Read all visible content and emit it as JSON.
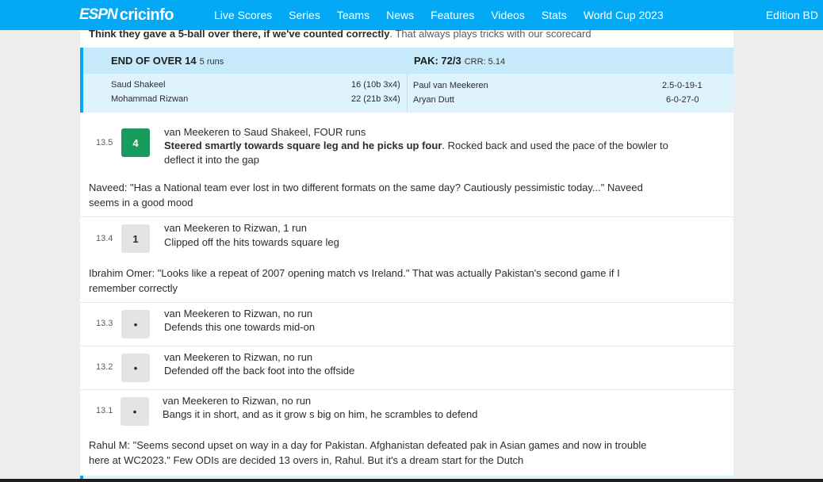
{
  "nav": {
    "logo_espn": "ESPN",
    "logo_cricinfo": "cricinfo",
    "items": [
      "Live Scores",
      "Series",
      "Teams",
      "News",
      "Features",
      "Videos",
      "Stats",
      "World Cup 2023"
    ],
    "edition": "Edition BD"
  },
  "teaser": {
    "bold": "Think they gave a 5-ball over there, if we've counted correctly",
    "rest": ". That always plays tricks with our scorecard"
  },
  "over_summary": {
    "title": "END OF OVER 14",
    "runs": "5 runs",
    "score": "PAK: 72/3",
    "crr": "CRR: 5.14",
    "batters": [
      {
        "name": "Saud Shakeel",
        "stats": "16 (10b 3x4)"
      },
      {
        "name": "Mohammad Rizwan",
        "stats": "22 (21b 3x4)"
      }
    ],
    "bowlers": [
      {
        "name": "Paul van Meekeren",
        "figures": "2.5-0-19-1"
      },
      {
        "name": "Aryan Dutt",
        "figures": "6-0-27-0"
      }
    ]
  },
  "balls": [
    {
      "num": "13.5",
      "result": "4",
      "title": "van Meekeren to Saud Shakeel, FOUR runs",
      "text_bold": "Steered smartly towards square leg and he picks up four",
      "text": ". Rocked back and used the pace of the bowler to deflect it into the gap",
      "comment": "Naveed: \"Has a National team ever lost in two different formats on the same day? Cautiously pessimistic today...\" Naveed seems in a good mood"
    },
    {
      "num": "13.4",
      "result": "1",
      "title": "van Meekeren to Rizwan, 1 run",
      "text": "Clipped off the hits towards square leg",
      "comment": "Ibrahim Omer: \"Looks like a repeat of 2007 opening match vs Ireland.\" That was actually Pakistan's second game if I remember correctly"
    },
    {
      "num": "13.3",
      "result": "•",
      "title": "van Meekeren to Rizwan, no run",
      "text": "Defends this one towards mid-on"
    },
    {
      "num": "13.2",
      "result": "•",
      "title": "van Meekeren to Rizwan, no run",
      "text": "Defended off the back foot into the offside"
    },
    {
      "num": "13.1",
      "result": "•",
      "title": "van Meekeren to Rizwan, no run",
      "text": "Bangs it in short, and as it grow s big on him, he scrambles to defend",
      "comment": "Rahul M: \"Seems second upset on way in a day for Pakistan. Afghanistan defeated pak in Asian games and now in trouble here at WC2023.\" Few ODIs are decided 13 overs in, Rahul. But it's a dream start for the Dutch"
    }
  ],
  "colors": {
    "nav_bg": "#03a9f4",
    "four_badge": "#1a9b5e",
    "over_bg": "#dff3fd"
  }
}
